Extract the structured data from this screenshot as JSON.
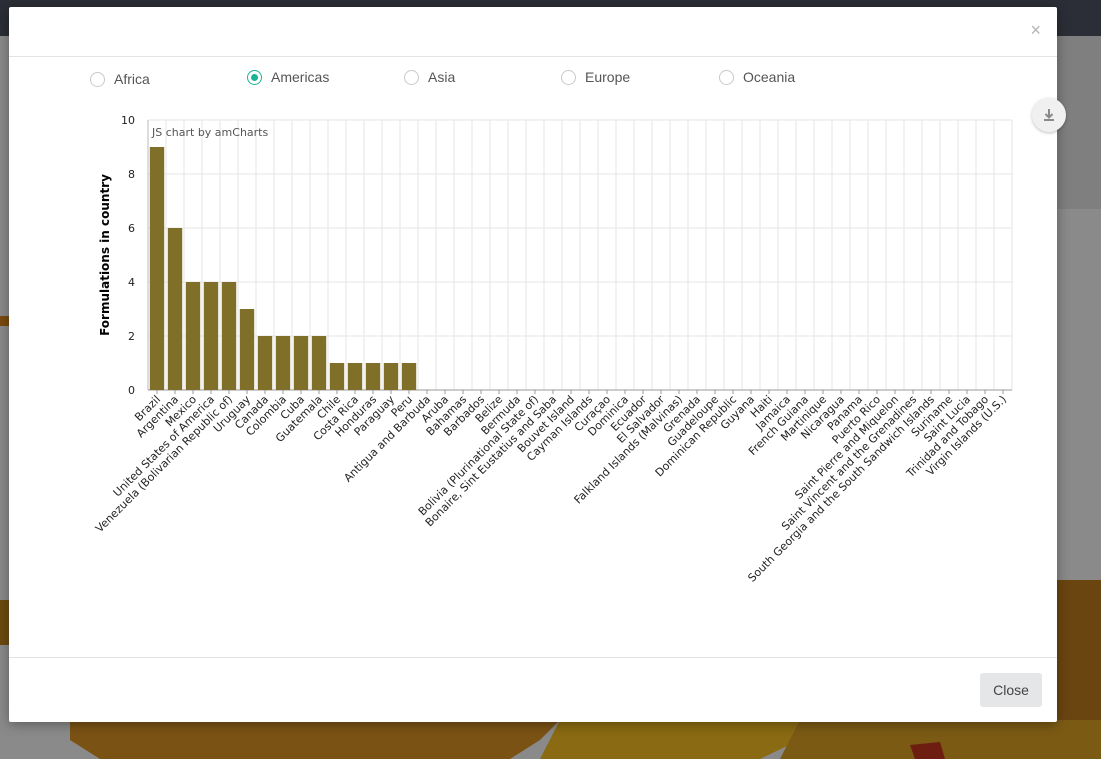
{
  "modal": {
    "close_symbol": "×",
    "close_button_label": "Close"
  },
  "regions": [
    {
      "label": "Africa",
      "checked": false
    },
    {
      "label": "Americas",
      "checked": true
    },
    {
      "label": "Asia",
      "checked": false
    },
    {
      "label": "Europe",
      "checked": false
    },
    {
      "label": "Oceania",
      "checked": false
    }
  ],
  "icons": {
    "export": "download-icon",
    "close": "close-icon"
  },
  "colors": {
    "bar": "#7f6f29",
    "accent": "#1ab394",
    "grid": "#e6e6e6"
  },
  "chart_data": {
    "type": "bar",
    "credit": "JS chart by amCharts",
    "ylabel": "Formulations in country",
    "xlabel": "",
    "ylim": [
      0,
      10
    ],
    "yticks": [
      0,
      2,
      4,
      6,
      8,
      10
    ],
    "grid": true,
    "categories": [
      "Brazil",
      "Argentina",
      "Mexico",
      "United States of America",
      "Venezuela (Bolivarian Republic of)",
      "Uruguay",
      "Canada",
      "Colombia",
      "Cuba",
      "Guatemala",
      "Chile",
      "Costa Rica",
      "Honduras",
      "Paraguay",
      "Peru",
      "Antigua and Barbuda",
      "Aruba",
      "Bahamas",
      "Barbados",
      "Belize",
      "Bermuda",
      "Bolivia (Plurinational State of)",
      "Bonaire, Sint Eustatius and Saba",
      "Bouvet Island",
      "Cayman Islands",
      "Curaçao",
      "Dominica",
      "Ecuador",
      "El Salvador",
      "Falkland Islands (Malvinas)",
      "Grenada",
      "Guadeloupe",
      "Dominican Republic",
      "Guyana",
      "Haiti",
      "Jamaica",
      "French Guiana",
      "Martinique",
      "Nicaragua",
      "Panama",
      "Puerto Rico",
      "Saint Pierre and Miquelon",
      "Saint Vincent and the Grenadines",
      "South Georgia and the South Sandwich Islands",
      "Suriname",
      "Saint Lucia",
      "Trinidad and Tobago",
      "Virgin Islands (U.S.)"
    ],
    "values": [
      9,
      6,
      4,
      4,
      4,
      3,
      2,
      2,
      2,
      2,
      1,
      1,
      1,
      1,
      1,
      0,
      0,
      0,
      0,
      0,
      0,
      0,
      0,
      0,
      0,
      0,
      0,
      0,
      0,
      0,
      0,
      0,
      0,
      0,
      0,
      0,
      0,
      0,
      0,
      0,
      0,
      0,
      0,
      0,
      0,
      0,
      0,
      0
    ]
  }
}
